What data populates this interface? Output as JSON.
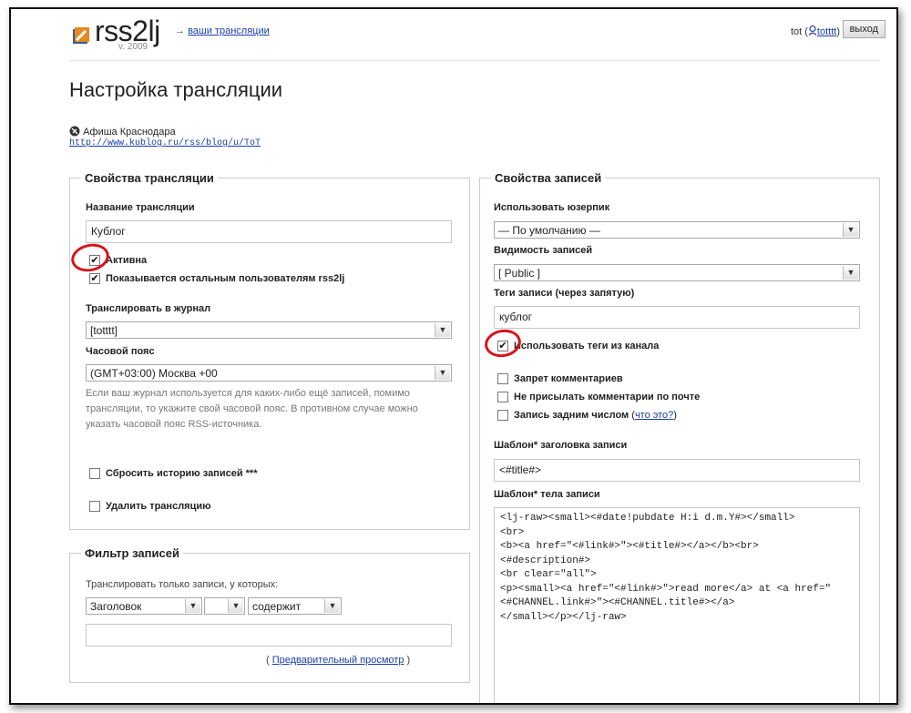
{
  "header": {
    "logo_text": "rss2lj",
    "logo_version": "v. 2009",
    "arrow": "→",
    "nav_link": "ваши трансляции",
    "user_prefix": "tot (",
    "user_link": "totttt",
    "user_suffix": ")",
    "logout": "выход"
  },
  "page_title": "Настройка трансляции",
  "source": {
    "name": "Афиша Краснодара",
    "url": "http://www.kublog.ru/rss/blog/u/ToT"
  },
  "stream_props": {
    "legend": "Свойства трансляции",
    "name_label": "Название трансляции",
    "name_value": "Кублог",
    "active_label": "Активна",
    "active_checked": "✔",
    "shown_label": "Показывается остальным пользователям rss2lj",
    "shown_checked": "✔",
    "journal_label": "Транслировать в журнал",
    "journal_value": "[totttt]",
    "tz_label": "Часовой пояс",
    "tz_value": "(GMT+03:00) Москва +00",
    "tz_help": "Если ваш журнал используется для каких-либо ещё записей, помимо трансляции, то укажите свой часовой пояс. В противном случае можно указать часовой пояс RSS-источника.",
    "reset_label": "Сбросить историю записей ***",
    "delete_label": "Удалить трансляцию"
  },
  "filter": {
    "legend": "Фильтр записей",
    "only_label": "Транслировать только записи, у которых:",
    "field_value": "Заголовок",
    "mid_value": "",
    "op_value": "содержит",
    "text_value": "",
    "preview_open": "(",
    "preview_link": "Предварительный просмотр",
    "preview_close": ")"
  },
  "entry_props": {
    "legend": "Свойства записей",
    "userpic_label": "Использовать юзерпик",
    "userpic_value": "— По умолчанию —",
    "visibility_label": "Видимость записей",
    "visibility_value": "[ Public ]",
    "tags_label": "Теги записи (через запятую)",
    "tags_value": "кублог",
    "use_tags_label": "Использовать теги из канала",
    "use_tags_checked": "✔",
    "no_comments_label": "Запрет комментариев",
    "no_mail_label": "Не присылать комментарии по почте",
    "backdate_label": "Запись задним числом",
    "backdate_open": "(",
    "backdate_link": "что это?",
    "backdate_close": ")",
    "title_tpl_label": "Шаблон* заголовка записи",
    "title_tpl_value": "<#title#>",
    "body_tpl_label": "Шаблон* тела записи",
    "body_tpl_value": "<lj-raw><small><#date!pubdate H:i d.m.Y#></small>\n<br>\n<b><a href=\"<#link#>\"><#title#></a></b><br>\n<#description#>\n<br clear=\"all\">\n<p><small><a href=\"<#link#>\">read more</a> at <a href=\"<#CHANNEL.link#>\"><#CHANNEL.title#></a>\n</small></p></lj-raw>"
  },
  "colors": {
    "link": "#1a3ea8",
    "annotation_red": "#d9151a",
    "border": "#cccccc"
  },
  "icons": {
    "logo": "rss2lj-logo-icon",
    "user": "user-icon",
    "source": "lj-source-icon",
    "dropdown": "chevron-down-icon"
  }
}
